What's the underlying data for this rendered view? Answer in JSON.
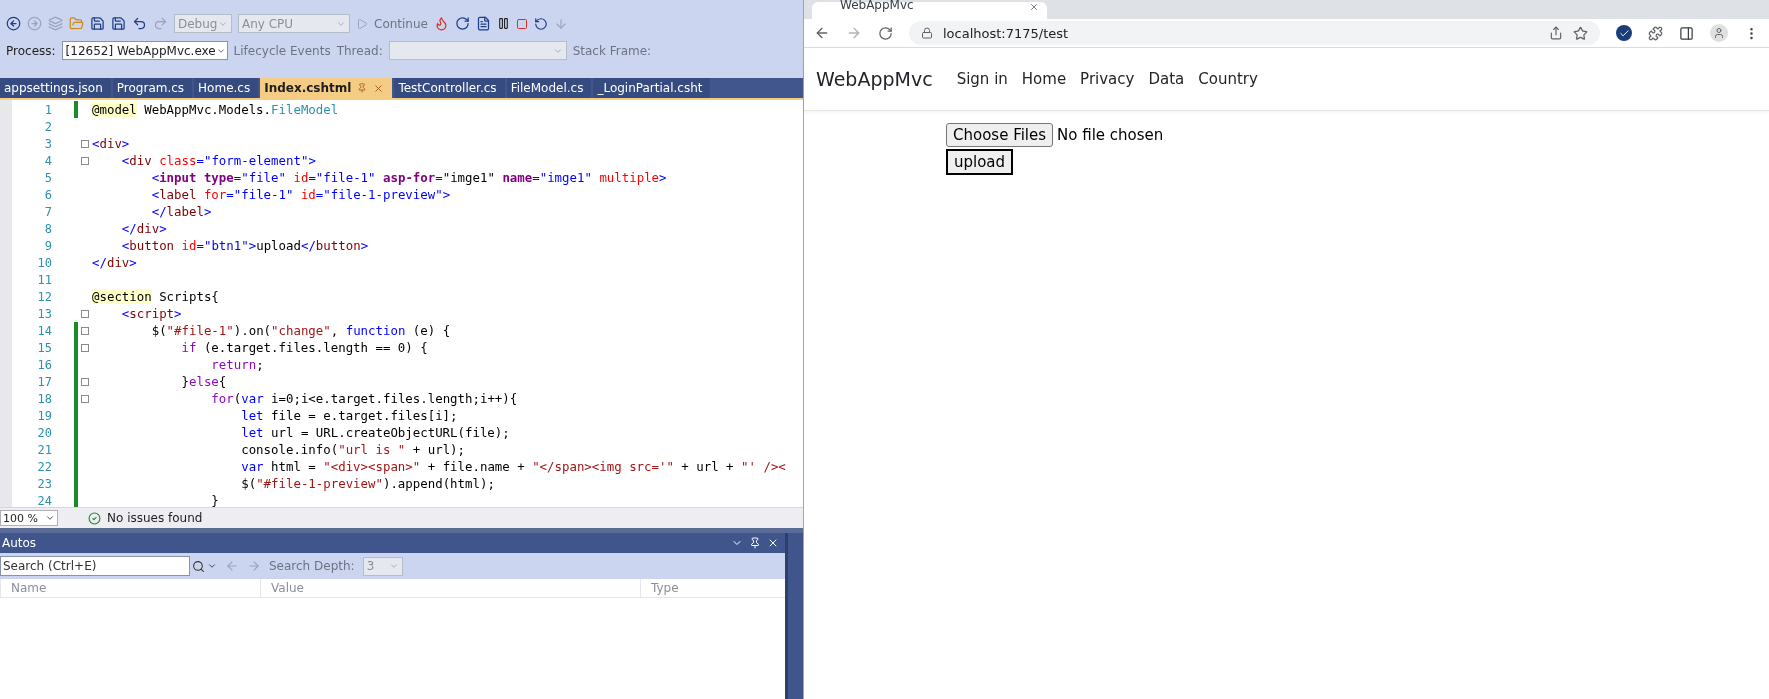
{
  "ide": {
    "toolbar": {
      "configuration": "Debug",
      "platform": "Any CPU",
      "continue_label": "Continue"
    },
    "debug_bar": {
      "process_label": "Process:",
      "process": "[12652] WebAppMvc.exe",
      "lifecycle": "Lifecycle Events",
      "thread_label": "Thread:",
      "stack_frame_label": "Stack Frame:"
    },
    "tabs": [
      {
        "label": "appsettings.json",
        "selected": false
      },
      {
        "label": "Program.cs",
        "selected": false
      },
      {
        "label": "Home.cs",
        "selected": false
      },
      {
        "label": "Index.cshtml",
        "selected": true
      },
      {
        "label": "TestController.cs",
        "selected": false
      },
      {
        "label": "FileModel.cs",
        "selected": false
      },
      {
        "label": "_LoginPartial.csht",
        "selected": false
      }
    ],
    "code_lines": [
      {
        "number": "1",
        "changed": true,
        "foldable": false,
        "tokens": [
          {
            "kind": "razor",
            "text": "@model"
          },
          {
            "kind": "plain",
            "text": " WebAppMvc.Models."
          },
          {
            "kind": "type",
            "text": "FileModel"
          }
        ]
      },
      {
        "number": "2",
        "changed": false,
        "foldable": false
      },
      {
        "number": "3",
        "changed": false,
        "foldable": true,
        "tokens": [
          {
            "kind": "tag",
            "text": "<"
          },
          {
            "kind": "tagname",
            "text": "div"
          },
          {
            "kind": "tag",
            "text": ">"
          }
        ]
      },
      {
        "number": "4",
        "changed": false,
        "foldable": true,
        "tokens": [
          {
            "kind": "tag",
            "text": "    <"
          },
          {
            "kind": "tagname",
            "text": "div"
          },
          {
            "kind": "attr",
            "text": " class"
          },
          {
            "kind": "tag",
            "text": "="
          },
          {
            "kind": "value",
            "text": "\"form-element\""
          },
          {
            "kind": "tag",
            "text": ">"
          }
        ]
      },
      {
        "number": "5",
        "changed": false,
        "foldable": false,
        "tokens": [
          {
            "kind": "tag",
            "text": "        <"
          },
          {
            "kind": "helper",
            "text": "input"
          },
          {
            "kind": "helper",
            "text": " type"
          },
          {
            "kind": "tag",
            "text": "="
          },
          {
            "kind": "value",
            "text": "\"file\""
          },
          {
            "kind": "attr",
            "text": " id"
          },
          {
            "kind": "tag",
            "text": "="
          },
          {
            "kind": "value",
            "text": "\"file-1\""
          },
          {
            "kind": "helper",
            "text": " asp-for"
          },
          {
            "kind": "tag",
            "text": "="
          },
          {
            "kind": "plain",
            "text": "\"imge1\""
          },
          {
            "kind": "helper",
            "text": " name"
          },
          {
            "kind": "tag",
            "text": "="
          },
          {
            "kind": "value",
            "text": "\"imge1\""
          },
          {
            "kind": "attr",
            "text": " multiple"
          },
          {
            "kind": "tag",
            "text": ">"
          }
        ]
      },
      {
        "number": "6",
        "changed": false,
        "foldable": false,
        "tokens": [
          {
            "kind": "tag",
            "text": "        <"
          },
          {
            "kind": "tagname",
            "text": "label"
          },
          {
            "kind": "attr",
            "text": " for"
          },
          {
            "kind": "tag",
            "text": "="
          },
          {
            "kind": "value",
            "text": "\"file-1\""
          },
          {
            "kind": "attr",
            "text": " id"
          },
          {
            "kind": "tag",
            "text": "="
          },
          {
            "kind": "value",
            "text": "\"file-1-preview\""
          },
          {
            "kind": "tag",
            "text": ">"
          }
        ]
      },
      {
        "number": "7",
        "changed": false,
        "foldable": false,
        "tokens": [
          {
            "kind": "tag",
            "text": "        </"
          },
          {
            "kind": "tagname",
            "text": "label"
          },
          {
            "kind": "tag",
            "text": ">"
          }
        ]
      },
      {
        "number": "8",
        "changed": false,
        "foldable": false,
        "tokens": [
          {
            "kind": "tag",
            "text": "    </"
          },
          {
            "kind": "tagname",
            "text": "div"
          },
          {
            "kind": "tag",
            "text": ">"
          }
        ]
      },
      {
        "number": "9",
        "changed": false,
        "foldable": false,
        "tokens": [
          {
            "kind": "tag",
            "text": "    <"
          },
          {
            "kind": "tagname",
            "text": "button"
          },
          {
            "kind": "attr",
            "text": " id"
          },
          {
            "kind": "tag",
            "text": "="
          },
          {
            "kind": "value",
            "text": "\"btn1\""
          },
          {
            "kind": "tag",
            "text": ">"
          },
          {
            "kind": "plain",
            "text": "upload"
          },
          {
            "kind": "tag",
            "text": "</"
          },
          {
            "kind": "tagname",
            "text": "button"
          },
          {
            "kind": "tag",
            "text": ">"
          }
        ]
      },
      {
        "number": "10",
        "changed": false,
        "foldable": false,
        "tokens": [
          {
            "kind": "tag",
            "text": "</"
          },
          {
            "kind": "tagname",
            "text": "div"
          },
          {
            "kind": "tag",
            "text": ">"
          }
        ]
      },
      {
        "number": "11",
        "changed": false,
        "foldable": false
      },
      {
        "number": "12",
        "changed": false,
        "foldable": false,
        "tokens": [
          {
            "kind": "razor",
            "text": "@section"
          },
          {
            "kind": "plain",
            "text": " Scripts{"
          }
        ]
      },
      {
        "number": "13",
        "changed": false,
        "foldable": true,
        "tokens": [
          {
            "kind": "tag",
            "text": "    <"
          },
          {
            "kind": "tagname",
            "text": "script"
          },
          {
            "kind": "tag",
            "text": ">"
          }
        ]
      },
      {
        "number": "14",
        "changed": true,
        "foldable": true,
        "tokens": [
          {
            "kind": "plain",
            "text": "        $("
          },
          {
            "kind": "str",
            "text": "\"#file-1\""
          },
          {
            "kind": "plain",
            "text": ").on("
          },
          {
            "kind": "str",
            "text": "\"change\""
          },
          {
            "kind": "plain",
            "text": ", "
          },
          {
            "kind": "kw",
            "text": "function"
          },
          {
            "kind": "plain",
            "text": " (e) {"
          }
        ]
      },
      {
        "number": "15",
        "changed": true,
        "foldable": true,
        "tokens": [
          {
            "kind": "ctl",
            "text": "            if"
          },
          {
            "kind": "plain",
            "text": " (e.target.files.length == 0) {"
          }
        ]
      },
      {
        "number": "16",
        "changed": true,
        "foldable": false,
        "tokens": [
          {
            "kind": "ctl",
            "text": "                return"
          },
          {
            "kind": "plain",
            "text": ";"
          }
        ]
      },
      {
        "number": "17",
        "changed": true,
        "foldable": true,
        "tokens": [
          {
            "kind": "plain",
            "text": "            }"
          },
          {
            "kind": "ctl",
            "text": "else"
          },
          {
            "kind": "plain",
            "text": "{"
          }
        ]
      },
      {
        "number": "18",
        "changed": true,
        "foldable": true,
        "tokens": [
          {
            "kind": "ctl",
            "text": "                for"
          },
          {
            "kind": "plain",
            "text": "("
          },
          {
            "kind": "kw",
            "text": "var"
          },
          {
            "kind": "plain",
            "text": " i=0;i<e.target.files.length;i++){"
          }
        ]
      },
      {
        "number": "19",
        "changed": true,
        "foldable": false,
        "tokens": [
          {
            "kind": "kw",
            "text": "                    let"
          },
          {
            "kind": "plain",
            "text": " file = e.target.files[i];"
          }
        ]
      },
      {
        "number": "20",
        "changed": true,
        "foldable": false,
        "tokens": [
          {
            "kind": "kw",
            "text": "                    let"
          },
          {
            "kind": "plain",
            "text": " url = URL.createObjectURL(file);"
          }
        ]
      },
      {
        "number": "21",
        "changed": true,
        "foldable": false,
        "tokens": [
          {
            "kind": "plain",
            "text": "                    console.info("
          },
          {
            "kind": "str",
            "text": "\"url is \""
          },
          {
            "kind": "plain",
            "text": " + url);"
          }
        ]
      },
      {
        "number": "22",
        "changed": true,
        "foldable": false,
        "tokens": [
          {
            "kind": "kw",
            "text": "                    var"
          },
          {
            "kind": "plain",
            "text": " html = "
          },
          {
            "kind": "str",
            "text": "\"<div><span>\""
          },
          {
            "kind": "plain",
            "text": " + file.name + "
          },
          {
            "kind": "str",
            "text": "\"</span><img src='\""
          },
          {
            "kind": "plain",
            "text": " + url + "
          },
          {
            "kind": "str",
            "text": "\"' /><"
          }
        ]
      },
      {
        "number": "23",
        "changed": true,
        "foldable": false,
        "tokens": [
          {
            "kind": "plain",
            "text": "                    $("
          },
          {
            "kind": "str",
            "text": "\"#file-1-preview\""
          },
          {
            "kind": "plain",
            "text": ").append(html);"
          }
        ]
      },
      {
        "number": "24",
        "changed": true,
        "foldable": false,
        "tokens": [
          {
            "kind": "plain",
            "text": "                }"
          }
        ]
      }
    ],
    "status": {
      "zoom": "100 %",
      "issues": "No issues found"
    },
    "autos": {
      "title": "Autos",
      "search": {
        "placeholder": "Search (Ctrl+E)"
      },
      "depth_label": "Search Depth:",
      "depth": "3",
      "columns": [
        "Name",
        "Value",
        "Type"
      ]
    }
  },
  "browser": {
    "tab_title": "WebAppMvc",
    "address": "localhost:7175/test",
    "site": {
      "brand": "WebAppMvc",
      "nav": [
        "Sign in",
        "Home",
        "Privacy",
        "Data",
        "Country"
      ],
      "file_button": "Choose Files",
      "file_status": "No file chosen",
      "upload_button": "upload"
    }
  }
}
